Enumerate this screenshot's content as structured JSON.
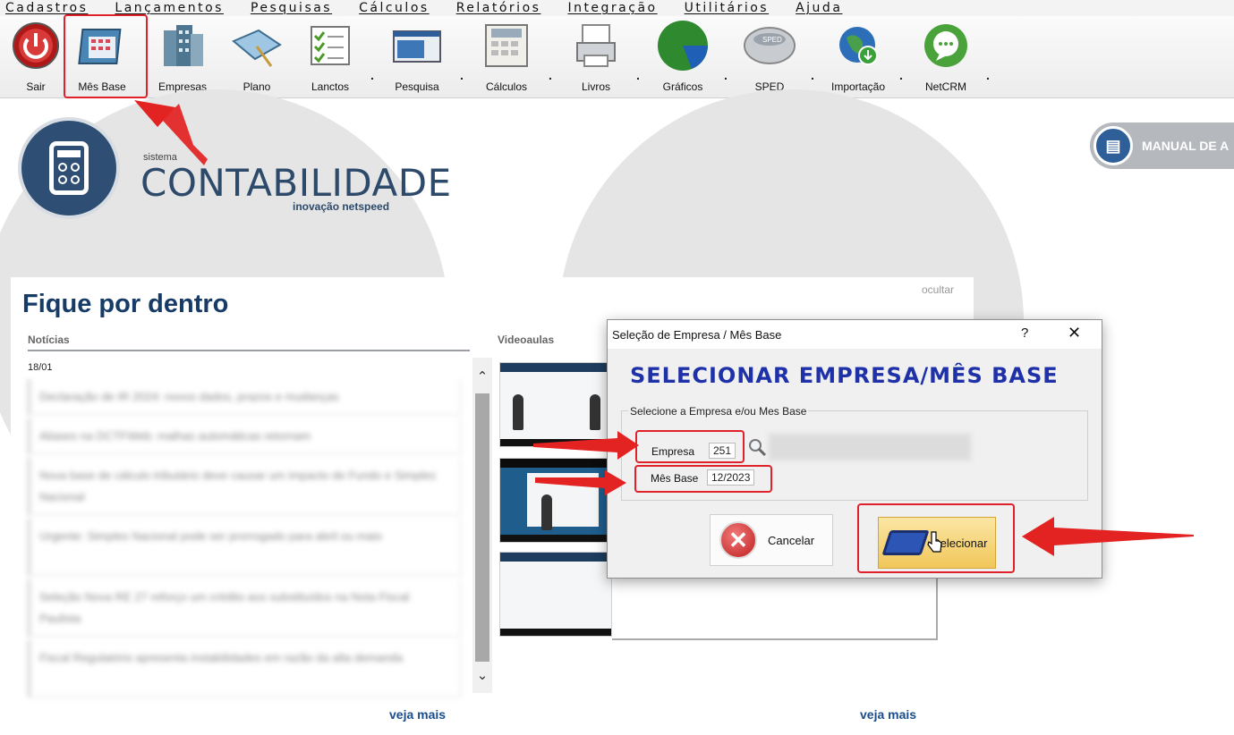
{
  "menubar": {
    "items": [
      "Cadastros",
      "Lançamentos",
      "Pesquisas",
      "Cálculos",
      "Relatórios",
      "Integração",
      "Utilitários",
      "Ajuda"
    ]
  },
  "toolbar": {
    "buttons": [
      "Sair",
      "Mês Base",
      "Empresas",
      "Plano",
      "Lanctos",
      "Pesquisa",
      "Cálculos",
      "Livros",
      "Gráficos",
      "SPED",
      "Importação",
      "NetCRM"
    ],
    "icons": [
      "power-icon",
      "calendar-icon",
      "buildings-icon",
      "book-icon",
      "checklist-icon",
      "search-window-icon",
      "calculator-icon",
      "printer-icon",
      "chart-icon",
      "sped-icon",
      "globe-download-icon",
      "chat-icon"
    ]
  },
  "branding": {
    "small": "sistema",
    "main": "CONTABILIDADE",
    "sub": "inovação netspeed"
  },
  "manual": {
    "label": "MANUAL DE A"
  },
  "news_panel": {
    "title": "Fique por dentro",
    "hide": "ocultar",
    "news_header": "Notícias",
    "video_header": "Videoaulas",
    "date": "18/01",
    "items": [
      "Declaração de IR 2024: novos dados, prazos e mudanças",
      "Aliases na DCTFWeb: malhas automáticas retornam",
      "Nova base de cálculo tributário deve causar um impacto de Fundo e Simples Nacional",
      "Urgente: Simples Nacional pode ser prorrogado para abril ou maio",
      "Seleção Nova RE 27 reforço um crédito aos substituídos na Nota Fiscal Paulista",
      "Fiscal Regulatório apresenta instabilidades em razão da alta demanda"
    ],
    "see_more_news": "veja mais",
    "see_more_videos": "veja mais"
  },
  "dialog": {
    "title": "Seleção de Empresa / Mês Base",
    "help": "?",
    "close": "✕",
    "heading": "SELECIONAR EMPRESA/MÊS BASE",
    "group_label": "Selecione a Empresa e/ou Mes Base",
    "empresa_label": "Empresa",
    "empresa_value": "251",
    "mes_label": "Mês Base",
    "mes_value": "12/2023",
    "cancel": "Cancelar",
    "select": "Selecionar"
  },
  "colors": {
    "accent_red": "#e0202a",
    "brand_blue": "#163b66",
    "dialog_heading": "#1e31a8"
  }
}
